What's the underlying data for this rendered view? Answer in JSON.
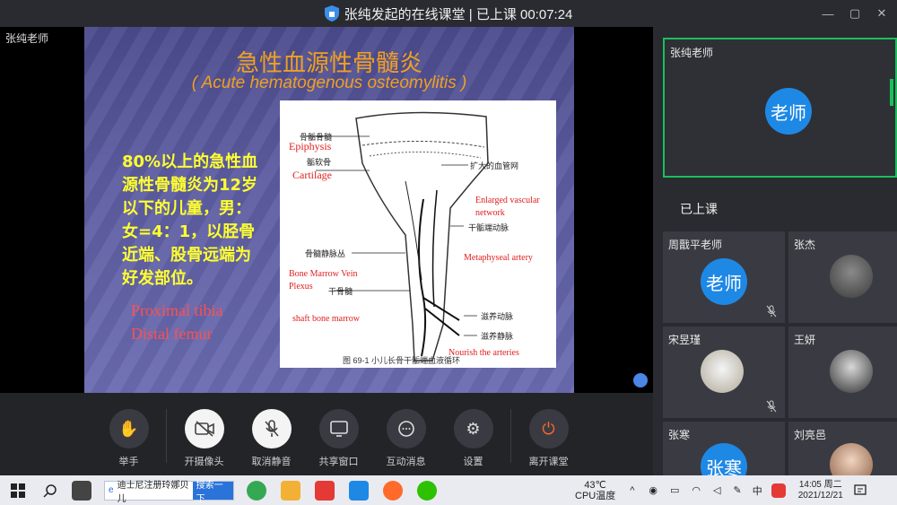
{
  "window": {
    "title": "张纯发起的在线课堂 | 已上课 00:07:24",
    "controls": [
      "—",
      "▢",
      "✕"
    ]
  },
  "stage": {
    "host_label": "张纯老师",
    "slide": {
      "title": "急性血源性骨髓炎",
      "subtitle": "( Acute hematogenous osteomylitis )",
      "body": [
        "80%以上的急性血",
        "源性骨髓炎为12岁",
        "以下的儿童，男：",
        "女=4：1，以胫骨",
        "近端、股骨远端为",
        "好发部位。"
      ],
      "red_lines": [
        "Proximal tibia",
        "Distal femur"
      ],
      "figure": {
        "labels_en": [
          "Epiphysis",
          "Cartilage",
          "Enlarged vascular",
          "network",
          "Metaphyseal artery",
          "Bone Marrow Vein",
          "Plexus",
          "shaft bone marrow",
          "Nourish the arteries"
        ],
        "labels_cn": [
          "骨骺骨髓",
          "骺软骨",
          "扩大的血管网",
          "干骺端动脉",
          "骨髓静脉丛",
          "干骨髓",
          "滋养动脉",
          "滋养静脉"
        ],
        "caption": "图 69-1  小儿长骨干骺端血液循环"
      }
    }
  },
  "toolbar": {
    "items": [
      {
        "label": "举手",
        "icon": "hand-icon"
      },
      {
        "label": "开摄像头",
        "icon": "camera-off-icon"
      },
      {
        "label": "取消静音",
        "icon": "mic-off-icon"
      },
      {
        "label": "共享窗口",
        "icon": "share-screen-icon"
      },
      {
        "label": "互动消息",
        "icon": "chat-icon"
      },
      {
        "label": "设置",
        "icon": "gear-icon"
      },
      {
        "label": "离开课堂",
        "icon": "power-icon"
      }
    ]
  },
  "sidebar": {
    "main_tile": {
      "name": "张纯老师",
      "avatar": "老师"
    },
    "section_title": "已上课",
    "participants": [
      {
        "name": "周戬平老师",
        "avatar": "老师"
      },
      {
        "name": "张杰",
        "avatar": ""
      },
      {
        "name": "宋昱瑾",
        "avatar": ""
      },
      {
        "name": "王妍",
        "avatar": ""
      },
      {
        "name": "张寒",
        "avatar": "张寒"
      },
      {
        "name": "刘亮邑",
        "avatar": ""
      }
    ]
  },
  "taskbar": {
    "search_text": "迪士尼注册玲娜贝儿",
    "search_button": "搜索一下",
    "cpu_temp": "43℃",
    "cpu_label": "CPU温度",
    "ime": "中",
    "time": "14:05 周二",
    "date": "2021/12/21"
  },
  "colors": {
    "accent": "#1e88e5",
    "active_border": "#19c05a",
    "slide_title": "#f0a020",
    "slide_body": "#ffff30",
    "slide_red": "#ff5050",
    "end_call": "#ff6a2a"
  }
}
